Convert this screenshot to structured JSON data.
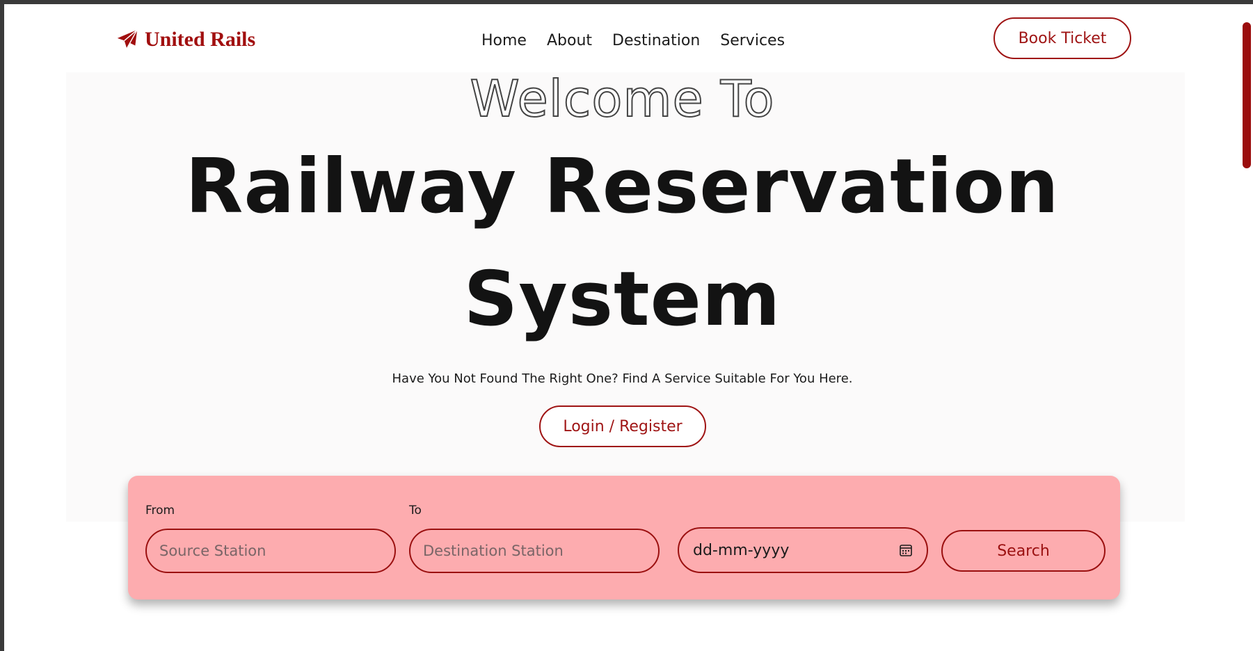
{
  "brand": {
    "name": "United Rails",
    "icon": "paper-plane-icon",
    "color": "#a10f0f"
  },
  "nav": {
    "links": [
      {
        "label": "Home"
      },
      {
        "label": "About"
      },
      {
        "label": "Destination"
      },
      {
        "label": "Services"
      }
    ],
    "book_ticket_label": "Book Ticket"
  },
  "hero": {
    "welcome": "Welcome To",
    "title_line_1": "Railway Reservation",
    "title_line_2": "System",
    "subtitle": "Have You Not Found The Right One? Find A Service Suitable For You Here.",
    "login_register_label": "Login / Register"
  },
  "search": {
    "from_label": "From",
    "from_placeholder": "Source Station",
    "to_label": "To",
    "to_placeholder": "Destination Station",
    "date_placeholder": "dd-mm-yyyy",
    "date_icon": "calendar-icon",
    "search_label": "Search"
  },
  "colors": {
    "accent": "#9f1414",
    "panel": "#fdacaf",
    "hero_bg": "#fbfafa",
    "scrollbar_thumb": "#9b0d0d"
  }
}
